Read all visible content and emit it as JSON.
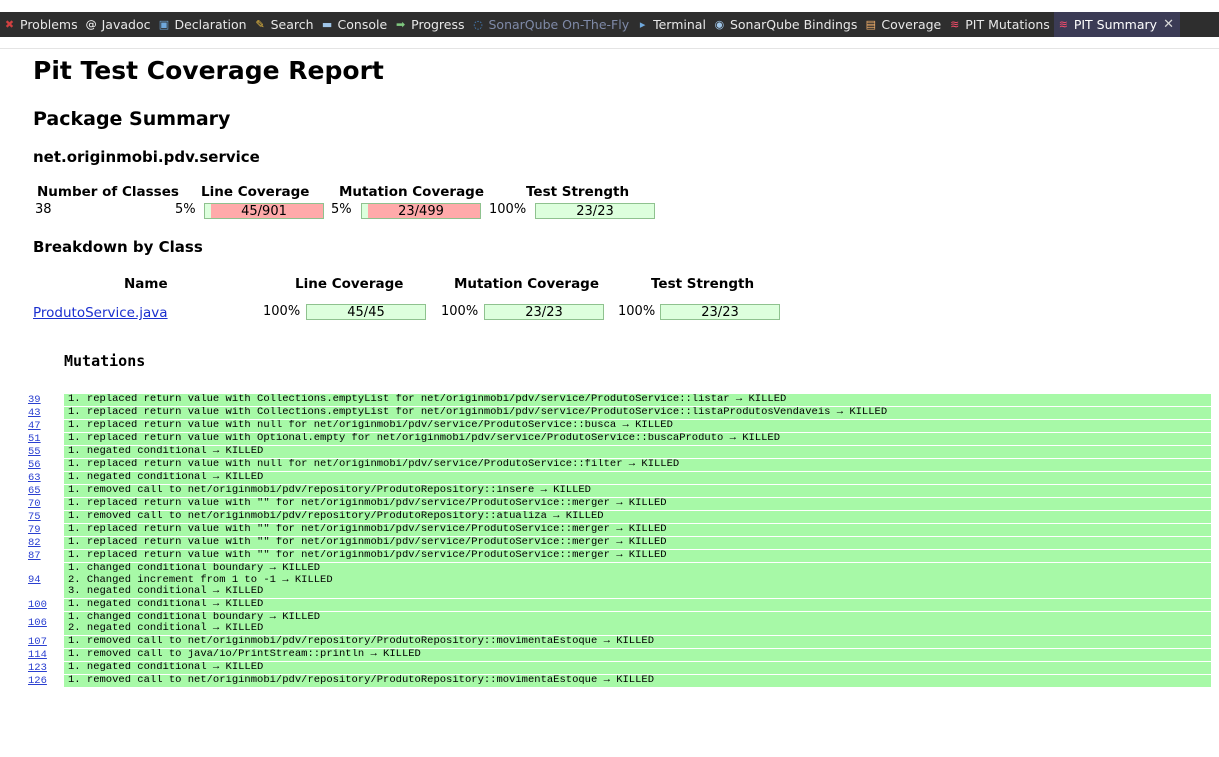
{
  "tabs": [
    {
      "label": "Problems",
      "icon": "problems-icon",
      "glyph": "✖",
      "color": "#d04040"
    },
    {
      "label": "Javadoc",
      "icon": "javadoc-icon",
      "glyph": "@",
      "color": "#ffffff"
    },
    {
      "label": "Declaration",
      "icon": "declaration-icon",
      "glyph": "▣",
      "color": "#6fa8dc"
    },
    {
      "label": "Search",
      "icon": "search-icon",
      "glyph": "✎",
      "color": "#f0c040"
    },
    {
      "label": "Console",
      "icon": "console-icon",
      "glyph": "▬",
      "color": "#9fc5e8"
    },
    {
      "label": "Progress",
      "icon": "progress-icon",
      "glyph": "➡",
      "color": "#7fc97f"
    },
    {
      "label": "SonarQube On-The-Fly",
      "icon": "sonarqube-icon",
      "glyph": "◌",
      "color": "#4a90d9",
      "muted": true
    },
    {
      "label": "Terminal",
      "icon": "terminal-icon",
      "glyph": "▸",
      "color": "#6fa8dc"
    },
    {
      "label": "SonarQube Bindings",
      "icon": "sonarqube-bindings-icon",
      "glyph": "◉",
      "color": "#9fc5e8"
    },
    {
      "label": "Coverage",
      "icon": "coverage-icon",
      "glyph": "▤",
      "color": "#f6b26b"
    },
    {
      "label": "PIT Mutations",
      "icon": "pit-icon",
      "glyph": "≋",
      "color": "#ff4d6d"
    },
    {
      "label": "PIT Summary",
      "icon": "pit-icon",
      "glyph": "≋",
      "color": "#ff4d6d",
      "active": true
    }
  ],
  "report": {
    "title": "Pit Test Coverage Report",
    "package_summary": "Package Summary",
    "package_name": "net.originmobi.pdv.service",
    "summary_headers": {
      "classes": "Number of Classes",
      "line": "Line Coverage",
      "mutation": "Mutation Coverage",
      "strength": "Test Strength"
    },
    "summary": {
      "classes": "38",
      "line_pct": "5%",
      "line_ratio": "45/901",
      "line_fraction": 0.05,
      "mutation_pct": "5%",
      "mutation_ratio": "23/499",
      "mutation_fraction": 0.05,
      "strength_pct": "100%",
      "strength_ratio": "23/23",
      "strength_fraction": 1.0
    },
    "breakdown_title": "Breakdown by Class",
    "breakdown_headers": {
      "name": "Name",
      "line": "Line Coverage",
      "mutation": "Mutation Coverage",
      "strength": "Test Strength"
    },
    "breakdown_row": {
      "name": "ProdutoService.java",
      "line_pct": "100%",
      "line_ratio": "45/45",
      "mutation_pct": "100%",
      "mutation_ratio": "23/23",
      "strength_pct": "100%",
      "strength_ratio": "23/23"
    }
  },
  "mutations": {
    "title": "Mutations",
    "rows": [
      {
        "line": "39",
        "text": "1. replaced return value with Collections.emptyList for net/originmobi/pdv/service/ProdutoService::listar → KILLED"
      },
      {
        "line": "43",
        "text": "1. replaced return value with Collections.emptyList for net/originmobi/pdv/service/ProdutoService::listaProdutosVendaveis → KILLED"
      },
      {
        "line": "47",
        "text": "1. replaced return value with null for net/originmobi/pdv/service/ProdutoService::busca → KILLED"
      },
      {
        "line": "51",
        "text": "1. replaced return value with Optional.empty for net/originmobi/pdv/service/ProdutoService::buscaProduto → KILLED"
      },
      {
        "line": "55",
        "text": "1. negated conditional → KILLED"
      },
      {
        "line": "56",
        "text": "1. replaced return value with null for net/originmobi/pdv/service/ProdutoService::filter → KILLED"
      },
      {
        "line": "63",
        "text": "1. negated conditional → KILLED"
      },
      {
        "line": "65",
        "text": "1. removed call to net/originmobi/pdv/repository/ProdutoRepository::insere → KILLED"
      },
      {
        "line": "70",
        "text": "1. replaced return value with \"\" for net/originmobi/pdv/service/ProdutoService::merger → KILLED"
      },
      {
        "line": "75",
        "text": "1. removed call to net/originmobi/pdv/repository/ProdutoRepository::atualiza → KILLED"
      },
      {
        "line": "79",
        "text": "1. replaced return value with \"\" for net/originmobi/pdv/service/ProdutoService::merger → KILLED"
      },
      {
        "line": "82",
        "text": "1. replaced return value with \"\" for net/originmobi/pdv/service/ProdutoService::merger → KILLED"
      },
      {
        "line": "87",
        "text": "1. replaced return value with \"\" for net/originmobi/pdv/service/ProdutoService::merger → KILLED"
      },
      {
        "line": "94",
        "text": "1. changed conditional boundary → KILLED\n2. Changed increment from 1 to -1 → KILLED\n3. negated conditional → KILLED"
      },
      {
        "line": "100",
        "text": "1. negated conditional → KILLED"
      },
      {
        "line": "106",
        "text": "1. changed conditional boundary → KILLED\n2. negated conditional → KILLED"
      },
      {
        "line": "107",
        "text": "1. removed call to net/originmobi/pdv/repository/ProdutoRepository::movimentaEstoque → KILLED"
      },
      {
        "line": "114",
        "text": "1. removed call to java/io/PrintStream::println → KILLED"
      },
      {
        "line": "123",
        "text": "1. negated conditional → KILLED"
      },
      {
        "line": "126",
        "text": "1. removed call to net/originmobi/pdv/repository/ProdutoRepository::movimentaEstoque → KILLED"
      }
    ]
  },
  "colors": {
    "covered": "#ddffdd",
    "uncovered": "#ffaaaa",
    "killed": "#a7f9a7",
    "link": "#1a2fcf",
    "tabbar": "#2e2e2e",
    "active_tab": "#3b3b55"
  }
}
